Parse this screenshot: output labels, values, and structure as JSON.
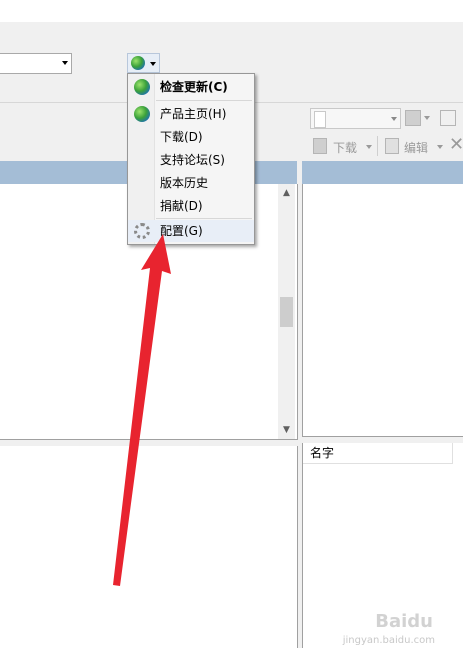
{
  "toolbar": {
    "server_combo_value": "",
    "update_button_icon": "update-globe-icon"
  },
  "menu": {
    "items": [
      {
        "label": "检查更新(C)",
        "icon": "update-globe-icon",
        "bold": true
      },
      {
        "label": "产品主页(H)",
        "icon": "globe-icon",
        "bold": false
      },
      {
        "label": "下载(D)",
        "icon": "",
        "bold": false
      },
      {
        "label": "支持论坛(S)",
        "icon": "",
        "bold": false
      },
      {
        "label": "版本历史",
        "icon": "",
        "bold": false
      },
      {
        "label": "捐献(D)",
        "icon": "",
        "bold": false
      },
      {
        "label": "配置(G)",
        "icon": "gear-icon",
        "bold": false
      }
    ]
  },
  "right_toolbar": {
    "download_label": "下载",
    "edit_label": "编辑"
  },
  "file_list": {
    "columns": [
      "名字"
    ]
  },
  "watermark": {
    "brand": "Baidu",
    "sub": "jingyan.baidu.com"
  },
  "colors": {
    "panel_header": "#a4bdd6",
    "annotation_arrow": "#e8242f",
    "menu_bg": "#f5f5f5"
  }
}
